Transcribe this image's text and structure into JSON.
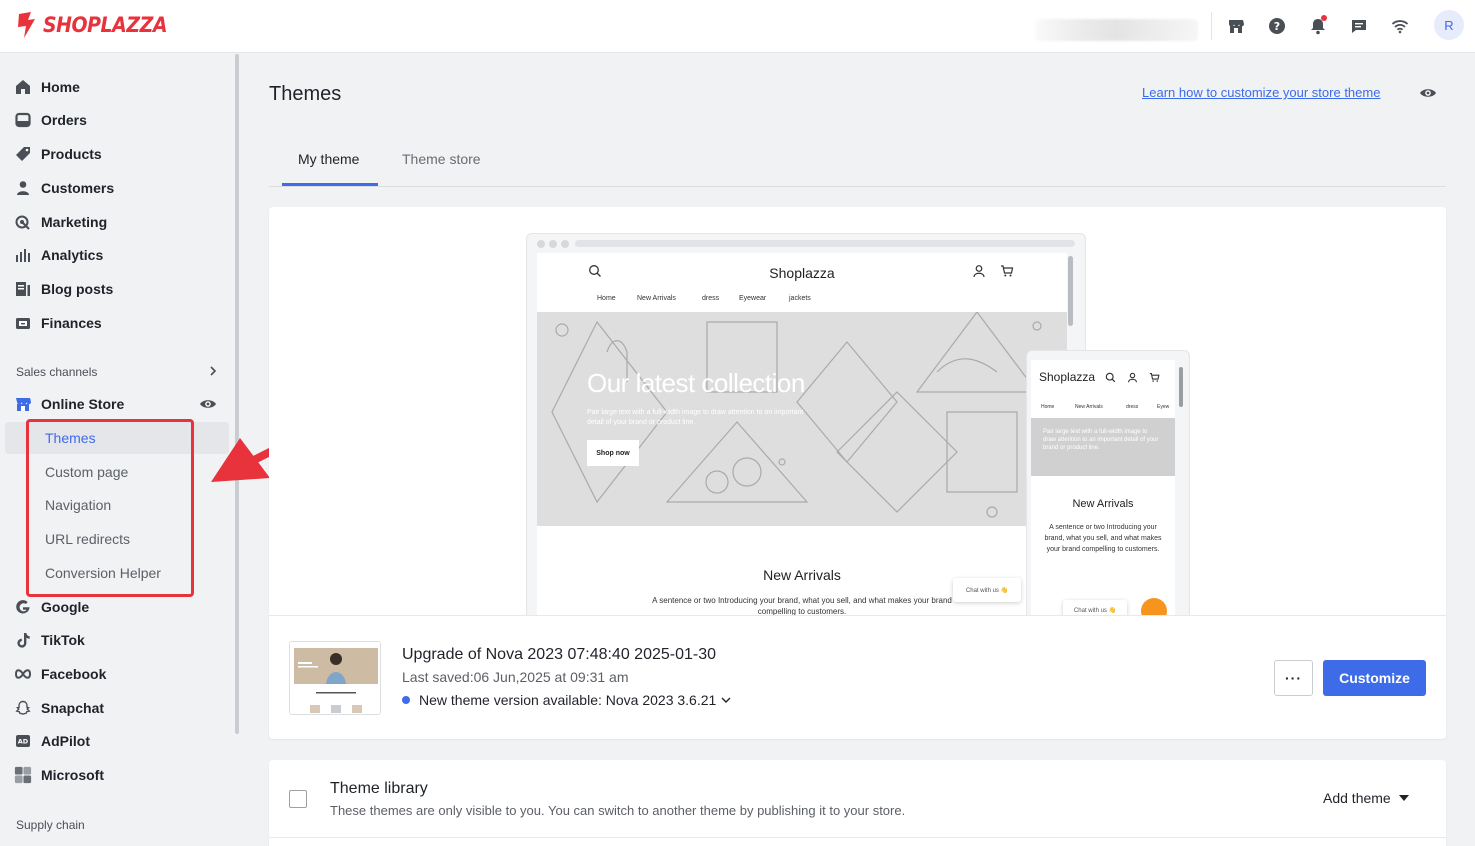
{
  "brand": {
    "name": "SHOPLAZZA",
    "color": "#e8323c"
  },
  "topbar": {
    "icons": [
      "store-icon",
      "help-icon",
      "bell-icon",
      "chat-icon",
      "wifi-icon"
    ],
    "avatar_initial": "R"
  },
  "sidebar": {
    "items": [
      {
        "label": "Home",
        "icon": "home-icon"
      },
      {
        "label": "Orders",
        "icon": "orders-icon"
      },
      {
        "label": "Products",
        "icon": "tag-icon"
      },
      {
        "label": "Customers",
        "icon": "person-icon"
      },
      {
        "label": "Marketing",
        "icon": "marketing-icon"
      },
      {
        "label": "Analytics",
        "icon": "bar-chart-icon"
      },
      {
        "label": "Blog posts",
        "icon": "blog-icon"
      },
      {
        "label": "Finances",
        "icon": "wallet-icon"
      }
    ],
    "sales_channels_label": "Sales channels",
    "online_store_label": "Online Store",
    "online_store_sub": [
      "Themes",
      "Custom page",
      "Navigation",
      "URL redirects",
      "Conversion Helper"
    ],
    "channels": [
      {
        "label": "Google",
        "icon": "google-icon"
      },
      {
        "label": "TikTok",
        "icon": "tiktok-icon"
      },
      {
        "label": "Facebook",
        "icon": "meta-icon"
      },
      {
        "label": "Snapchat",
        "icon": "snapchat-icon"
      },
      {
        "label": "AdPilot",
        "icon": "adpilot-icon"
      },
      {
        "label": "Microsoft",
        "icon": "microsoft-icon"
      }
    ],
    "supply_chain_label": "Supply chain"
  },
  "main": {
    "title": "Themes",
    "learn_link": "Learn how to customize your store theme",
    "tabs": [
      "My theme",
      "Theme store"
    ],
    "preview": {
      "store_name": "Shoplazza",
      "nav": [
        "Home",
        "New Arrivals",
        "dress",
        "Eyewear",
        "jackets"
      ],
      "hero_title": "Our latest collection",
      "hero_sub": "Pair large text with a full-width image to draw attention to an important detail of your brand or product line.",
      "hero_button": "Shop now",
      "arrivals_title": "New Arrivals",
      "arrivals_desc": "A sentence or two Introducing your brand, what you sell, and what makes your brand compelling to customers.",
      "chat_label": "Chat with us 👋",
      "mobile_nav": [
        "Home",
        "New Arrivals",
        "dress",
        "Eyew"
      ],
      "mobile_hero_text": "Pair large text with a full-width image to draw attention to an important detail of your brand or product line.",
      "mobile_desc": "A sentence or two Introducing your brand, what you sell, and what makes your brand compelling to customers."
    },
    "theme": {
      "name": "Upgrade of Nova 2023 07:48:40 2025-01-30",
      "last_saved": "Last saved:06 Jun,2025 at 09:31 am",
      "version_notice": "New theme version available: Nova 2023 3.6.21",
      "more_label": "···",
      "customize_label": "Customize"
    },
    "library": {
      "title": "Theme library",
      "desc": "These themes are only visible to you. You can switch to another theme by publishing it to your store.",
      "add_label": "Add theme"
    }
  },
  "colors": {
    "accent": "#3e6be8",
    "highlight": "#e8323c",
    "chat_orange": "#f7941d"
  }
}
